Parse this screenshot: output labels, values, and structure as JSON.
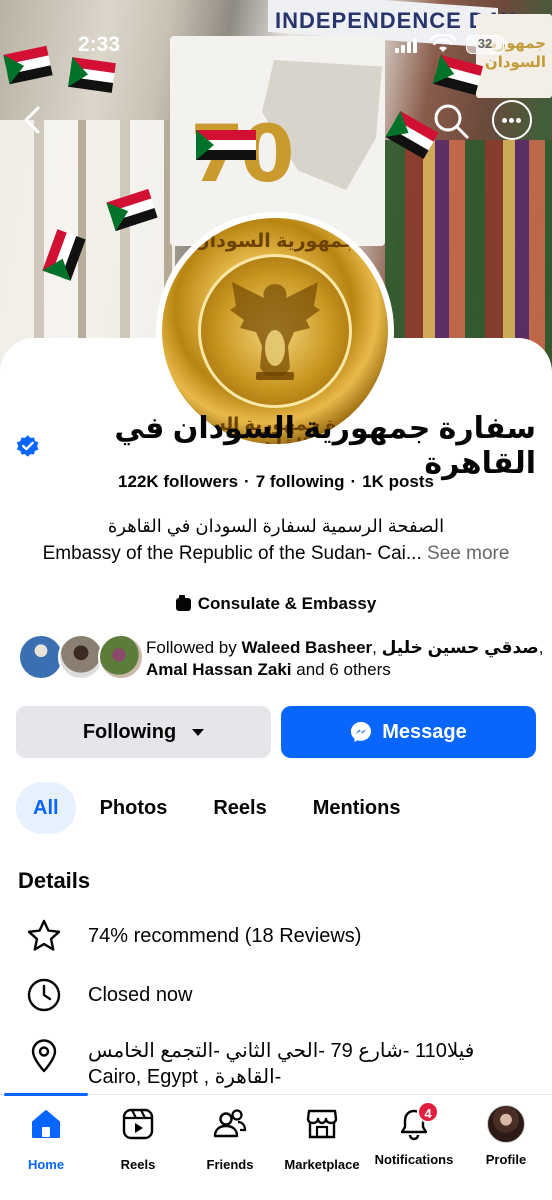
{
  "status_bar": {
    "time": "2:33",
    "battery": "32"
  },
  "cover": {
    "banner_text": "INDEPENDENCE DAY",
    "sign_text": "جمهورية السودان",
    "poster_number": "70"
  },
  "profile": {
    "avatar_text_top": "جمهورية السودان",
    "avatar_text_bottom": "سفارة جمهورية السودان القاهرة",
    "name": "سفارة جمهورية السودان في القاهرة",
    "followers": "122K followers",
    "following": "7 following",
    "posts": "1K posts",
    "separator": "·",
    "bio_ar": "الصفحة الرسمية لسفارة السودان في القاهرة",
    "bio_en": "Embassy of the Republic of the Sudan- Cai...",
    "see_more": "See more",
    "category": "Consulate & Embassy",
    "followed_by": {
      "prefix": "Followed by ",
      "name1": "Waleed Basheer",
      "sep1": ", ",
      "name2": "صدقي حسين خليل",
      "sep2": ", ",
      "name3": "Amal Hassan Zaki",
      "suffix": " and 6 others"
    }
  },
  "actions": {
    "following_label": "Following",
    "message_label": "Message"
  },
  "tabs": [
    {
      "label": "All"
    },
    {
      "label": "Photos"
    },
    {
      "label": "Reels"
    },
    {
      "label": "Mentions"
    }
  ],
  "details": {
    "title": "Details",
    "recommend": "74% recommend (18 Reviews)",
    "hours": "Closed now",
    "address": "فيلا110 -شارع 79 -الحي الثاني -التجمع الخامس -القاهرة , Cairo, Egypt"
  },
  "bottom_nav": {
    "items": [
      {
        "label": "Home"
      },
      {
        "label": "Reels"
      },
      {
        "label": "Friends"
      },
      {
        "label": "Marketplace"
      },
      {
        "label": "Notifications"
      },
      {
        "label": "Profile"
      }
    ],
    "notifications_badge": "4"
  },
  "colors": {
    "accent": "#0866ff",
    "badge": "#e41e3f",
    "button_gray": "#e4e6eb",
    "tab_active_bg": "#e7f0fd"
  }
}
